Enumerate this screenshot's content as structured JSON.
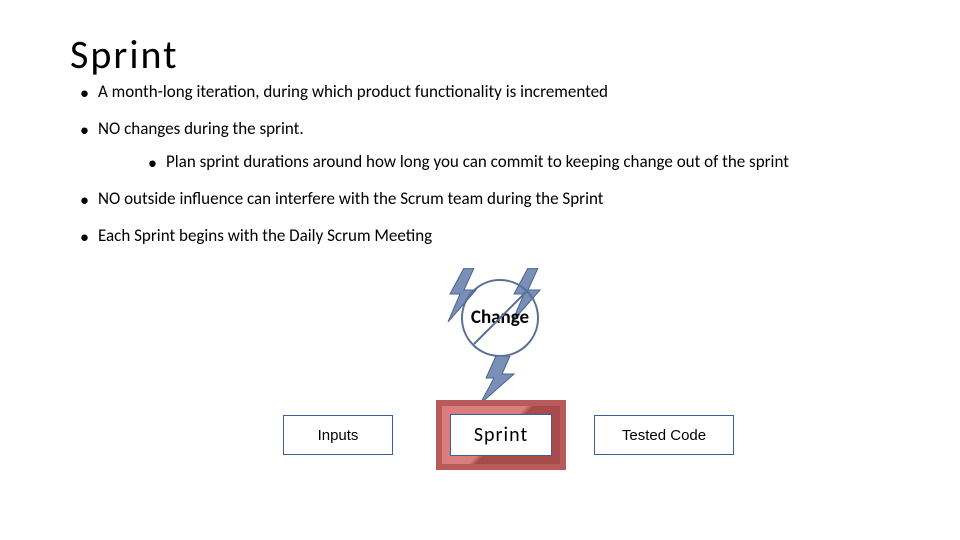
{
  "title": "Sprint",
  "bullets": {
    "b1": "A month-long iteration, during which product functionality is incremented",
    "b2": "NO changes during the sprint.",
    "b2a": "Plan sprint durations around how long you can commit to keeping change out of the sprint",
    "b3": "NO outside influence can interfere with the Scrum team during the Sprint",
    "b4": "Each Sprint begins with the Daily Scrum Meeting"
  },
  "diagram": {
    "change": "Change",
    "inputs": "Inputs",
    "sprint": "Sprint",
    "tested": "Tested Code"
  },
  "colors": {
    "bolt_fill": "#7a8fb8",
    "bolt_stroke": "#4a648f",
    "box_stroke": "#3b5ea3",
    "sprint_bevel": "#b85a5a",
    "prohibit_stroke": "#5a6f96"
  }
}
